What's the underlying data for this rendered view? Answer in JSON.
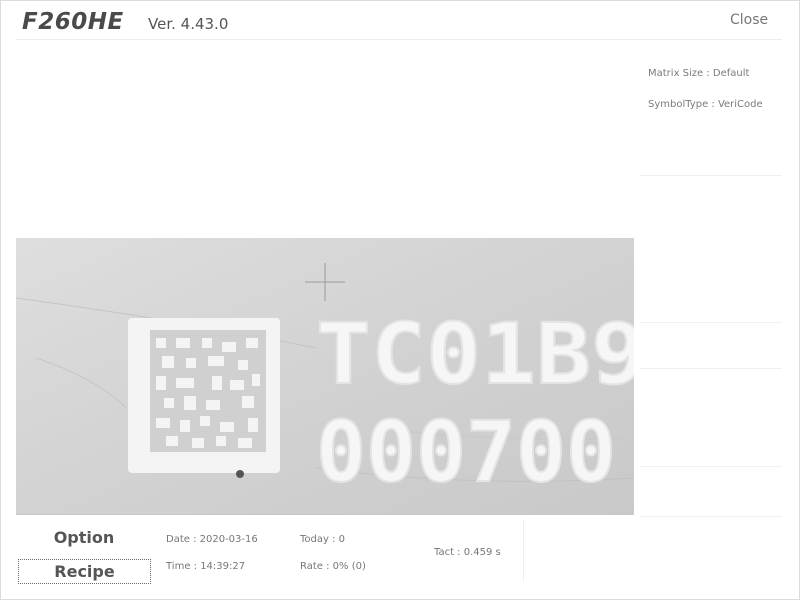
{
  "header": {
    "app_title": "F260HE",
    "version": "Ver. 4.43.0",
    "close_label": "Close"
  },
  "info_panel": {
    "matrix_size": "Matrix Size : Default",
    "symbol_type": "SymbolType : VeriCode"
  },
  "camera": {
    "line1": "TC01B9",
    "line2": "000700"
  },
  "footer": {
    "option_label": "Option",
    "recipe_label": "Recipe",
    "date": "Date : 2020-03-16",
    "time": "Time : 14:39:27",
    "today": "Today : 0",
    "rate": "Rate : 0% (0)",
    "tact": "Tact : 0.459 s"
  }
}
